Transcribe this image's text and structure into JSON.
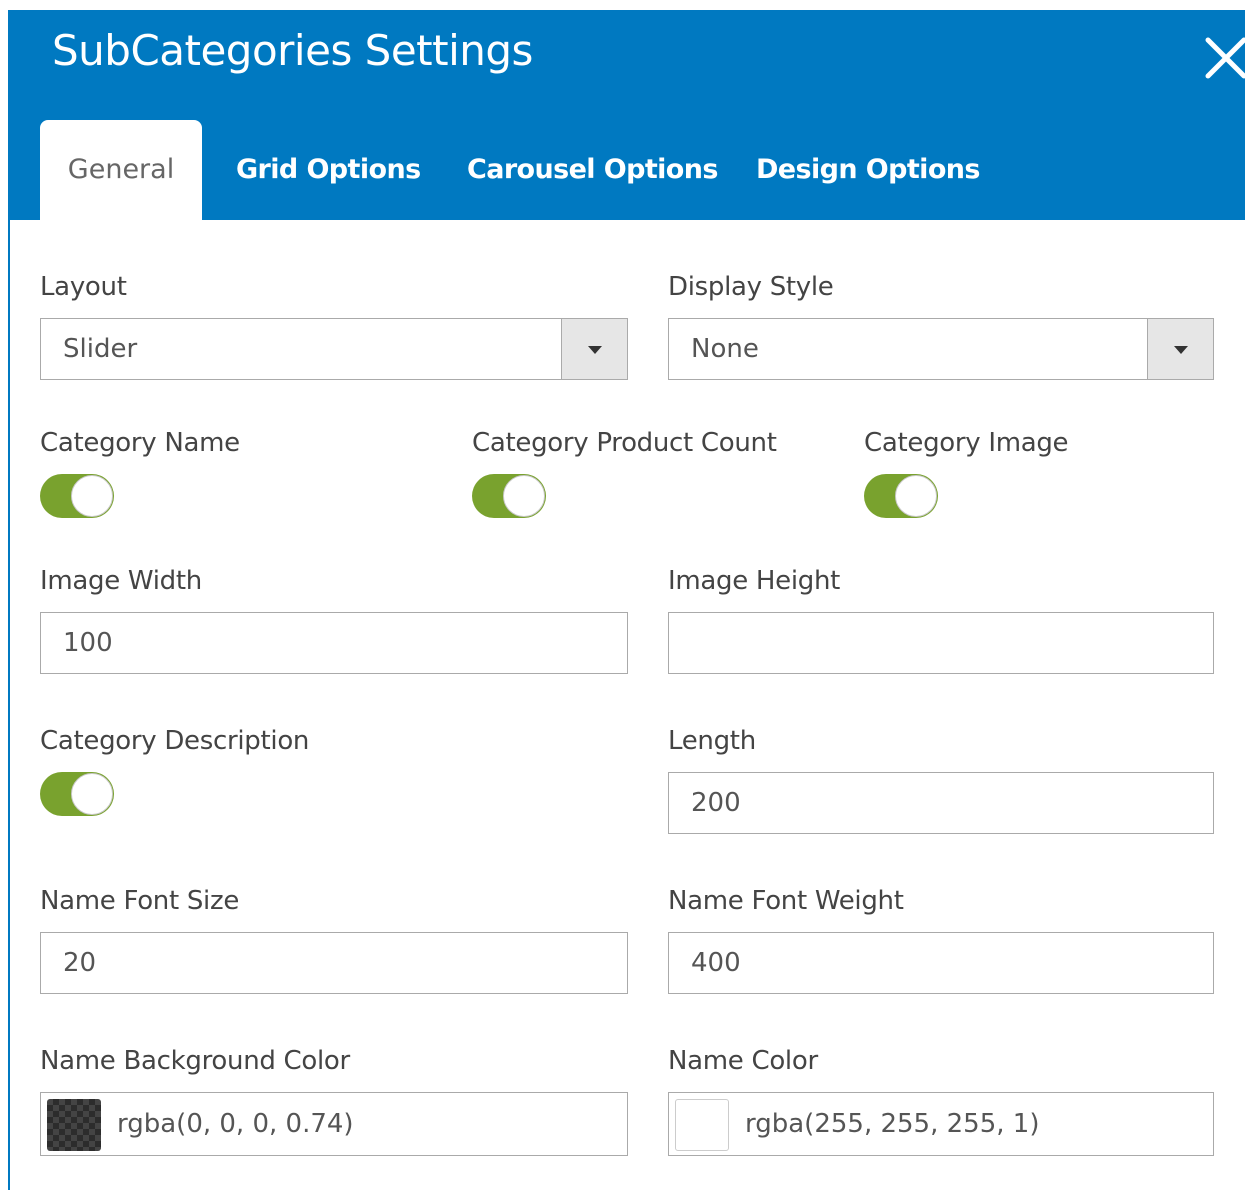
{
  "dialog": {
    "title": "SubCategories Settings",
    "close_icon": "close-icon"
  },
  "tabs": [
    {
      "label": "General",
      "active": true
    },
    {
      "label": "Grid Options",
      "active": false
    },
    {
      "label": "Carousel Options",
      "active": false
    },
    {
      "label": "Design Options",
      "active": false
    }
  ],
  "fields": {
    "layout": {
      "label": "Layout",
      "value": "Slider"
    },
    "display_style": {
      "label": "Display Style",
      "value": "None"
    },
    "category_name": {
      "label": "Category Name",
      "enabled": true
    },
    "category_product_count": {
      "label": "Category Product Count",
      "enabled": true
    },
    "category_image": {
      "label": "Category Image",
      "enabled": true
    },
    "image_width": {
      "label": "Image Width",
      "value": "100"
    },
    "image_height": {
      "label": "Image Height",
      "value": ""
    },
    "category_description": {
      "label": "Category Description",
      "enabled": true
    },
    "length": {
      "label": "Length",
      "value": "200"
    },
    "name_font_size": {
      "label": "Name Font Size",
      "value": "20"
    },
    "name_font_weight": {
      "label": "Name Font Weight",
      "value": "400"
    },
    "name_background_color": {
      "label": "Name Background Color",
      "value": "rgba(0, 0, 0, 0.74)"
    },
    "name_color": {
      "label": "Name Color",
      "value": "rgba(255, 255, 255, 1)"
    }
  },
  "colors": {
    "header_bg": "#0079c1",
    "toggle_on": "#79a22e",
    "border": "#aaaaaa"
  }
}
